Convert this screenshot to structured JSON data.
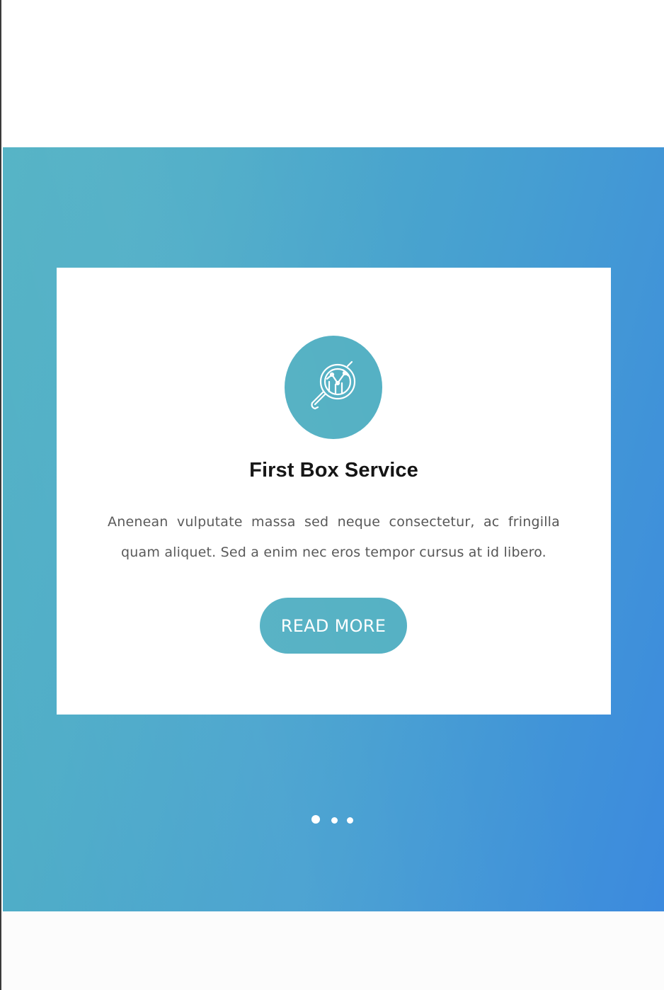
{
  "service_card": {
    "icon": "analytics-search-icon",
    "title": "First Box Service",
    "description": "Anenean vulputate massa sed neque consectetur, ac fringilla quam aliquet. Sed a enim nec eros tempor cursus at id libero.",
    "button_label": "READ MORE"
  },
  "carousel": {
    "slide_count": 3,
    "active_index": 0
  },
  "colors": {
    "accent": "#53b0c3",
    "gradient_start": "#52b2c4",
    "gradient_end": "#3c8ade",
    "title": "#111111",
    "body_text": "#555555"
  }
}
